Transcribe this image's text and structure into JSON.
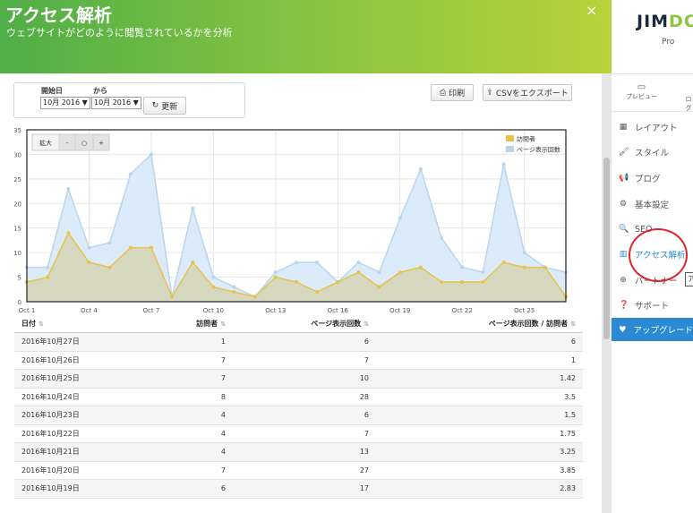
{
  "header": {
    "title": "アクセス解析",
    "subtitle": "ウェブサイトがどのように閲覧されているかを分析",
    "close": "×"
  },
  "filter": {
    "start_label": "開始日",
    "from_label": "から",
    "start_value": "10月 2016 ▼",
    "end_value": "10月 2016 ▼",
    "update_label": "更新",
    "update_icon": "refresh-icon"
  },
  "actions": {
    "print_label": "印刷",
    "print_icon": "printer-icon",
    "csv_label": "CSVをエクスポート",
    "csv_icon": "export-icon"
  },
  "chart_controls": {
    "zoom_label": "拡大",
    "minus": "-",
    "reset": "○",
    "plus": "+"
  },
  "chart_data": {
    "type": "area",
    "x": [
      "Oct 1",
      "Oct 2",
      "Oct 3",
      "Oct 4",
      "Oct 5",
      "Oct 6",
      "Oct 7",
      "Oct 8",
      "Oct 9",
      "Oct 10",
      "Oct 11",
      "Oct 12",
      "Oct 13",
      "Oct 14",
      "Oct 15",
      "Oct 16",
      "Oct 17",
      "Oct 18",
      "Oct 19",
      "Oct 20",
      "Oct 21",
      "Oct 22",
      "Oct 23",
      "Oct 24",
      "Oct 25",
      "Oct 26",
      "Oct 27"
    ],
    "xticks": [
      "Oct 1",
      "Oct 4",
      "Oct 7",
      "Oct 10",
      "Oct 13",
      "Oct 16",
      "Oct 19",
      "Oct 22",
      "Oct 25"
    ],
    "yticks": [
      0,
      5,
      10,
      15,
      20,
      25,
      30,
      35
    ],
    "ylim": [
      0,
      35
    ],
    "grid": true,
    "legend_position": "top-right",
    "series": [
      {
        "name": "ページ表示回数",
        "color": "#b9d5ee",
        "fill": "#dcebfa",
        "values": [
          7,
          7,
          23,
          11,
          12,
          26,
          30,
          1,
          19,
          5,
          3,
          1,
          6,
          8,
          8,
          4,
          8,
          6,
          17,
          27,
          13,
          7,
          6,
          28,
          10,
          7,
          6
        ]
      },
      {
        "name": "訪問者",
        "color": "#e8c24a",
        "fill": "#d5d6b4",
        "values": [
          4,
          5,
          14,
          8,
          7,
          11,
          11,
          1,
          8,
          3,
          2,
          1,
          5,
          4,
          2,
          4,
          6,
          3,
          6,
          7,
          4,
          4,
          4,
          8,
          7,
          7,
          1
        ]
      }
    ]
  },
  "table": {
    "headers": [
      "日付",
      "訪問者",
      "ページ表示回数",
      "ページ表示回数 / 訪問者"
    ],
    "rows": [
      [
        "2016年10月27日",
        "1",
        "6",
        "6"
      ],
      [
        "2016年10月26日",
        "7",
        "7",
        "1"
      ],
      [
        "2016年10月25日",
        "7",
        "10",
        "1.42"
      ],
      [
        "2016年10月24日",
        "8",
        "28",
        "3.5"
      ],
      [
        "2016年10月23日",
        "4",
        "6",
        "1.5"
      ],
      [
        "2016年10月22日",
        "4",
        "7",
        "1.75"
      ],
      [
        "2016年10月21日",
        "4",
        "13",
        "3.25"
      ],
      [
        "2016年10月20日",
        "7",
        "27",
        "3.85"
      ],
      [
        "2016年10月19日",
        "6",
        "17",
        "2.83"
      ]
    ]
  },
  "sidebar": {
    "logo_a": "JIM",
    "logo_b": "DO",
    "plan": "Pro",
    "tabs": [
      {
        "label": "プレビュー",
        "icon": "monitor-icon"
      },
      {
        "label": "ログ",
        "icon": "none"
      }
    ],
    "items": [
      {
        "label": "レイアウト",
        "icon": "layout-icon"
      },
      {
        "label": "スタイル",
        "icon": "brush-icon"
      },
      {
        "label": "ブログ",
        "icon": "megaphone-icon"
      },
      {
        "label": "基本設定",
        "icon": "gear-icon"
      },
      {
        "label": "SEO",
        "icon": "search-icon"
      },
      {
        "label": "アクセス解析",
        "icon": "bar-chart-icon"
      },
      {
        "label": "パートナー",
        "icon": "plus-circle-icon"
      },
      {
        "label": "サポート",
        "icon": "question-icon"
      }
    ],
    "upgrade_label": "アップグレード",
    "upgrade_icon": "heart-icon",
    "tooltip": "ア",
    "accent": "#2a8ad4",
    "highlight": "#e0242a"
  }
}
